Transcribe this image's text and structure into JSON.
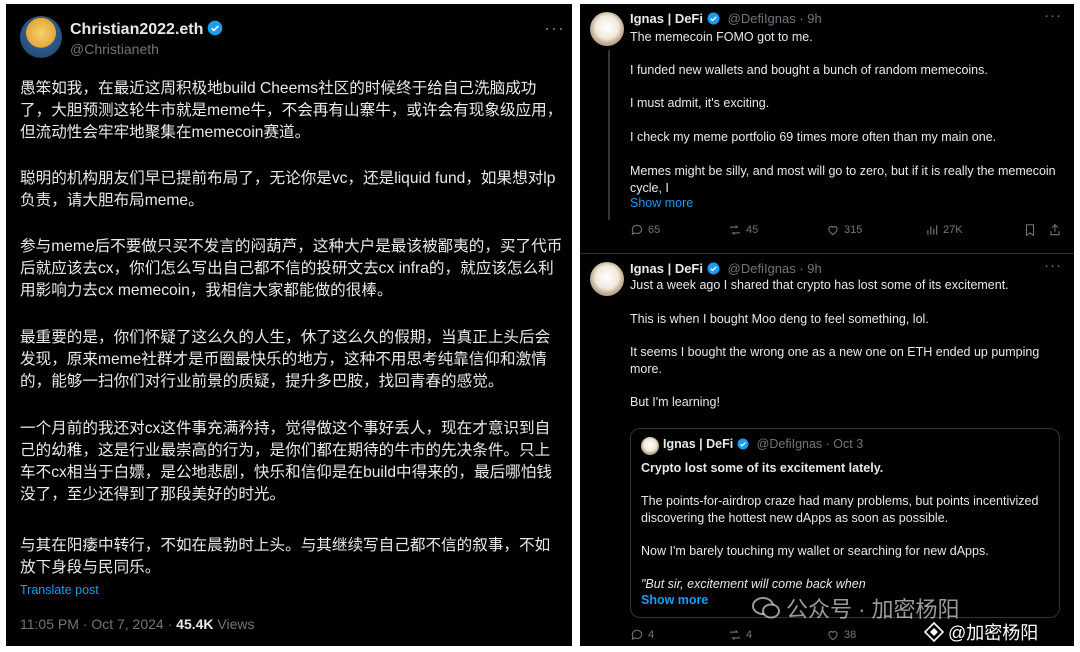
{
  "left_tweet": {
    "display_name": "Christian2022.eth",
    "handle": "@Christianeth",
    "paragraphs": [
      "愚笨如我，在最近这周积极地build Cheems社区的时候终于给自己洗脑成功了，大胆预测这轮牛市就是meme牛，不会再有山寨牛，或许会有现象级应用，但流动性会牢牢地聚集在memecoin赛道。",
      "聪明的机构朋友们早已提前布局了，无论你是vc，还是liquid fund，如果想对lp负责，请大胆布局meme。",
      "参与meme后不要做只买不发言的闷葫芦，这种大户是最该被鄙夷的，买了代币后就应该去cx，你们怎么写出自己都不信的投研文去cx infra的，就应该怎么利用影响力去cx memecoin，我相信大家都能做的很棒。",
      "最重要的是，你们怀疑了这么久的人生，休了这么久的假期，当真正上头后会发现，原来meme社群才是币圈最快乐的地方，这种不用思考纯靠信仰和激情的，能够一扫你们对行业前景的质疑，提升多巴胺，找回青春的感觉。",
      "一个月前的我还对cx这件事充满矜持，觉得做这个事好丢人，现在才意识到自己的幼稚，这是行业最崇高的行为，是你们都在期待的牛市的先决条件。只上车不cx相当于白嫖，是公地悲剧，快乐和信仰是在build中得来的，最后哪怕钱没了，至少还得到了那段美好的时光。",
      "与其在阳痿中转行，不如在晨勃时上头。与其继续写自己都不信的叙事，不如放下身段与民同乐。"
    ],
    "translate": "Translate post",
    "timestamp": "11:05 PM · Oct 7, 2024 · ",
    "views_count": "45.4K",
    "views_label": " Views"
  },
  "right_tweet_1": {
    "display_name": "Ignas | DeFi",
    "handle": "@DefiIgnas",
    "time": " · 9h",
    "lines": [
      "The memecoin FOMO got to me.",
      "I funded new wallets and bought a bunch of random memecoins.",
      "I must admit, it's exciting.",
      "I check my meme portfolio 69 times more often than my main one.",
      "Memes might be silly, and most will go to zero, but if it is really the memecoin cycle, I"
    ],
    "show_more": "Show more",
    "replies": "65",
    "reposts": "45",
    "likes": "315",
    "views": "27K"
  },
  "right_tweet_2": {
    "display_name": "Ignas | DeFi",
    "handle": "@DefiIgnas",
    "time": " · 9h",
    "lines": [
      "Just a week ago I shared that crypto has lost some of its excitement.",
      "This is when I bought Moo deng to feel something, lol.",
      "It seems I bought the wrong one as a new one on ETH ended up pumping more.",
      "But I'm learning!"
    ],
    "replies": "4",
    "reposts": "4",
    "likes": "38",
    "quote": {
      "display_name": "Ignas | DeFi",
      "handle": "@DefiIgnas",
      "time": " · Oct 3",
      "title": "Crypto lost some of its excitement lately.",
      "lines": [
        "The points-for-airdrop craze had many problems, but points incentivized discovering the hottest new dApps as soon as possible.",
        "Now I'm barely touching my wallet or searching for new dApps.",
        "\"But sir, excitement will come back when"
      ],
      "show_more": "Show more"
    }
  },
  "watermark": {
    "line1": "公众号 · 加密杨阳",
    "line2": "@加密杨阳"
  },
  "colors": {
    "background": "#000000",
    "accent": "#1d9bf0",
    "muted": "#71767b",
    "text": "#e7e9ea"
  }
}
